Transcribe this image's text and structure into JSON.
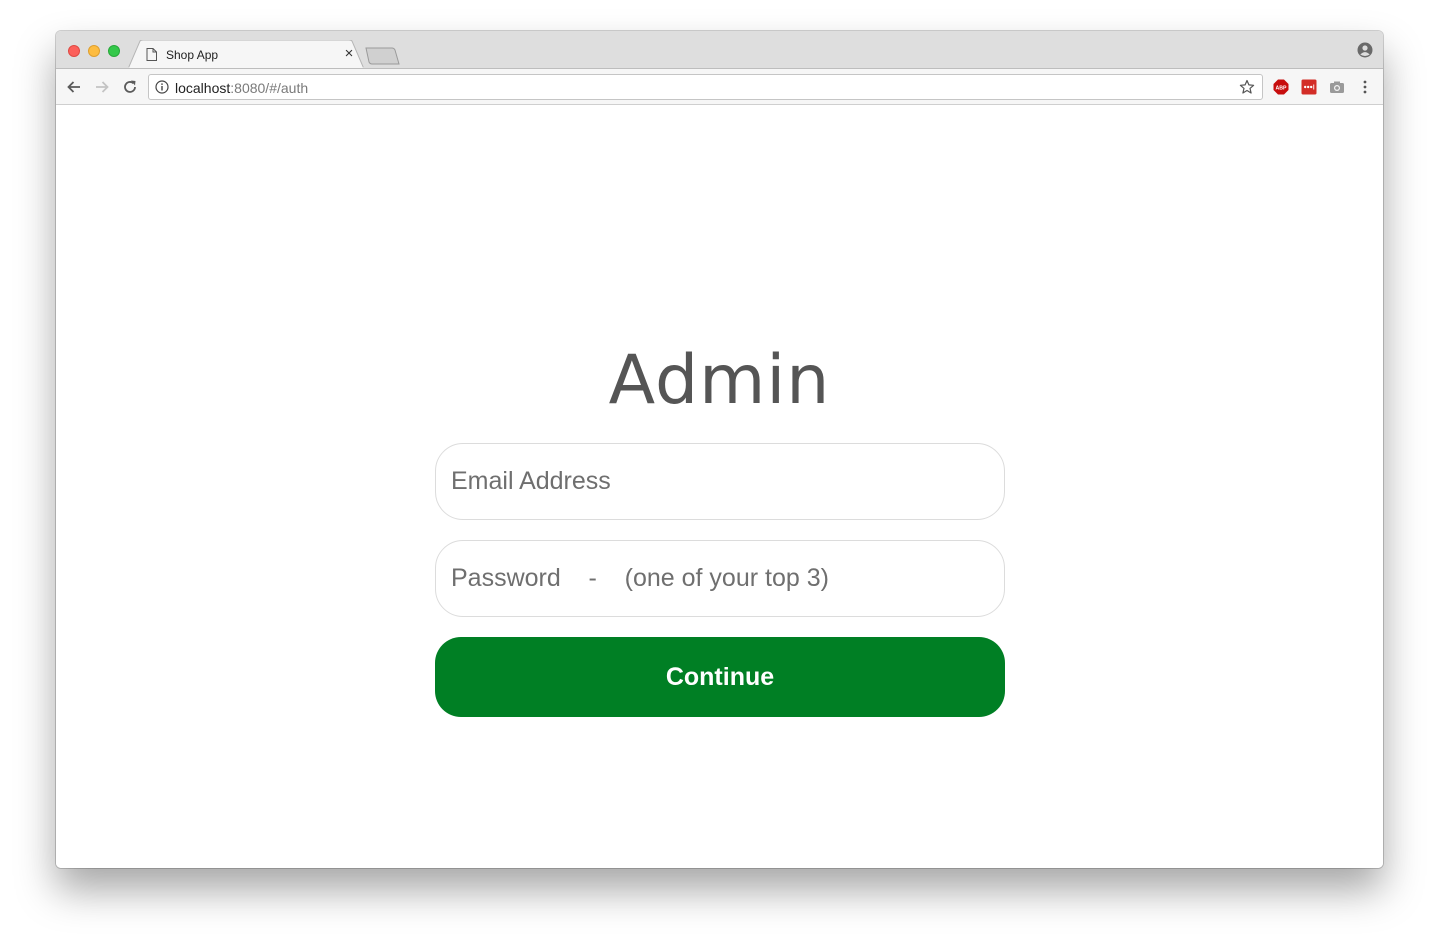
{
  "browser": {
    "tab_title": "Shop App",
    "url": {
      "host": "localhost",
      "rest": ":8080/#/auth"
    },
    "icons": [
      "document-icon",
      "close-icon",
      "new-tab",
      "profile-icon",
      "back-arrow-icon",
      "forward-arrow-icon",
      "reload-icon",
      "info-icon",
      "star-icon",
      "adblock-icon",
      "lastpass-icon",
      "camera-icon",
      "menu-icon"
    ]
  },
  "login": {
    "title": "Admin",
    "email_placeholder": "Email Address",
    "password_placeholder": "Password    -    (one of your top 3)",
    "continue_label": "Continue"
  },
  "colors": {
    "button": "#007f24",
    "heading": "#555555"
  }
}
